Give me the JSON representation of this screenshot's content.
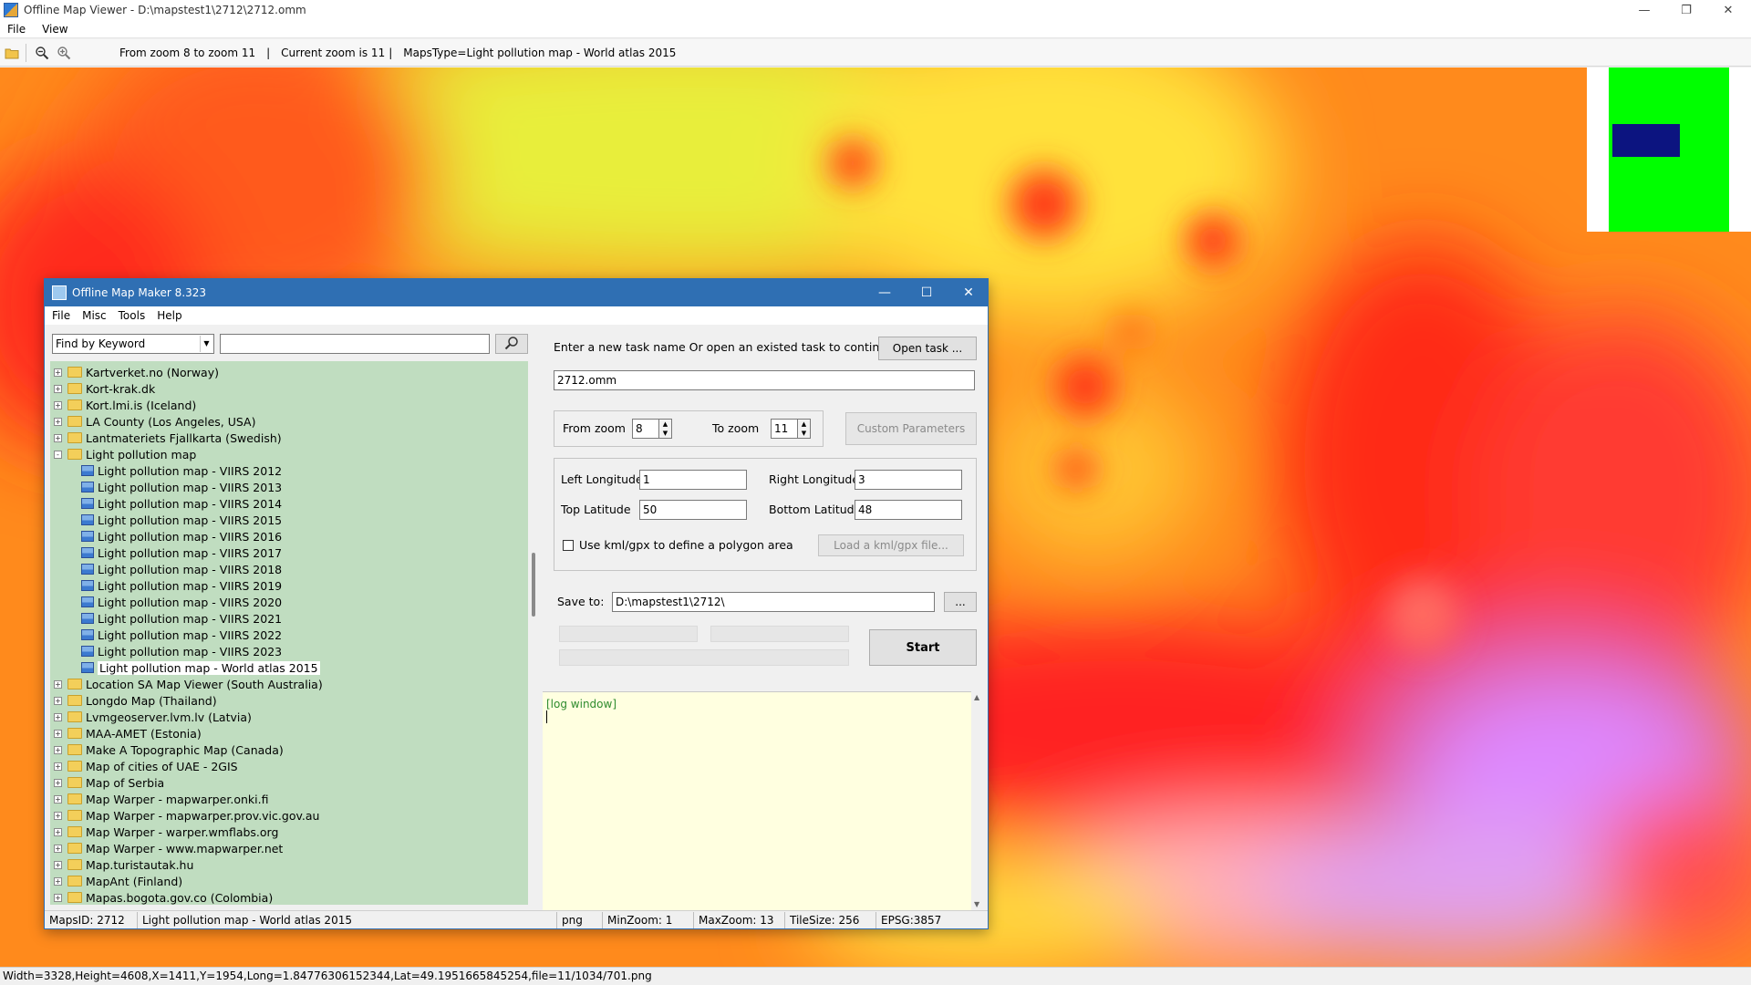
{
  "app": {
    "title": "Offline Map Viewer - D:\\mapstest1\\2712\\2712.omm",
    "menu": [
      "File",
      "View"
    ],
    "toolbar": {
      "zoom_range_text": "From zoom 8 to zoom 11",
      "current_zoom_text": "Current zoom is 11",
      "maps_type_text": "MapsType=Light pollution map - World atlas 2015",
      "separator": "|"
    },
    "status_text": "Width=3328,Height=4608,X=1411,Y=1954,Long=1.84776306152344,Lat=49.1951665845254,file=11/1034/701.png"
  },
  "dialog": {
    "title": "Offline Map Maker 8.323",
    "menu": [
      "File",
      "Misc",
      "Tools",
      "Help"
    ],
    "search": {
      "mode": "Find by Keyword",
      "query": ""
    },
    "tree": [
      {
        "label": "Kartverket.no (Norway)",
        "type": "folder",
        "level": 0,
        "expander": "+"
      },
      {
        "label": "Kort-krak.dk",
        "type": "folder",
        "level": 0,
        "expander": "+"
      },
      {
        "label": "Kort.lmi.is (Iceland)",
        "type": "folder",
        "level": 0,
        "expander": "+"
      },
      {
        "label": "LA County (Los Angeles, USA)",
        "type": "folder",
        "level": 0,
        "expander": "+"
      },
      {
        "label": "Lantmateriets Fjallkarta (Swedish)",
        "type": "folder",
        "level": 0,
        "expander": "+"
      },
      {
        "label": "Light pollution map",
        "type": "folder",
        "level": 0,
        "expander": "-"
      },
      {
        "label": "Light pollution map - VIIRS 2012",
        "type": "map",
        "level": 1
      },
      {
        "label": "Light pollution map - VIIRS 2013",
        "type": "map",
        "level": 1
      },
      {
        "label": "Light pollution map - VIIRS 2014",
        "type": "map",
        "level": 1
      },
      {
        "label": "Light pollution map - VIIRS 2015",
        "type": "map",
        "level": 1
      },
      {
        "label": "Light pollution map - VIIRS 2016",
        "type": "map",
        "level": 1
      },
      {
        "label": "Light pollution map - VIIRS 2017",
        "type": "map",
        "level": 1
      },
      {
        "label": "Light pollution map - VIIRS 2018",
        "type": "map",
        "level": 1
      },
      {
        "label": "Light pollution map - VIIRS 2019",
        "type": "map",
        "level": 1
      },
      {
        "label": "Light pollution map - VIIRS 2020",
        "type": "map",
        "level": 1
      },
      {
        "label": "Light pollution map - VIIRS 2021",
        "type": "map",
        "level": 1
      },
      {
        "label": "Light pollution map - VIIRS 2022",
        "type": "map",
        "level": 1
      },
      {
        "label": "Light pollution map - VIIRS 2023",
        "type": "map",
        "level": 1
      },
      {
        "label": "Light pollution map - World atlas 2015",
        "type": "map",
        "level": 1,
        "selected": true
      },
      {
        "label": "Location SA Map Viewer (South Australia)",
        "type": "folder",
        "level": 0,
        "expander": "+"
      },
      {
        "label": "Longdo Map (Thailand)",
        "type": "folder",
        "level": 0,
        "expander": "+"
      },
      {
        "label": "Lvmgeoserver.lvm.lv (Latvia)",
        "type": "folder",
        "level": 0,
        "expander": "+"
      },
      {
        "label": "MAA-AMET (Estonia)",
        "type": "folder",
        "level": 0,
        "expander": "+"
      },
      {
        "label": "Make A Topographic Map (Canada)",
        "type": "folder",
        "level": 0,
        "expander": "+"
      },
      {
        "label": "Map of cities of UAE - 2GIS",
        "type": "folder",
        "level": 0,
        "expander": "+"
      },
      {
        "label": "Map of Serbia",
        "type": "folder",
        "level": 0,
        "expander": "+"
      },
      {
        "label": "Map Warper - mapwarper.onki.fi",
        "type": "folder",
        "level": 0,
        "expander": "+"
      },
      {
        "label": "Map Warper - mapwarper.prov.vic.gov.au",
        "type": "folder",
        "level": 0,
        "expander": "+"
      },
      {
        "label": "Map Warper - warper.wmflabs.org",
        "type": "folder",
        "level": 0,
        "expander": "+"
      },
      {
        "label": "Map Warper - www.mapwarper.net",
        "type": "folder",
        "level": 0,
        "expander": "+"
      },
      {
        "label": "Map.turistautak.hu",
        "type": "folder",
        "level": 0,
        "expander": "+"
      },
      {
        "label": "MapAnt (Finland)",
        "type": "folder",
        "level": 0,
        "expander": "+"
      },
      {
        "label": "Mapas.bogota.gov.co (Colombia)",
        "type": "folder",
        "level": 0,
        "expander": "+"
      }
    ],
    "task": {
      "prompt": "Enter a new task name Or open an existed task to continue:",
      "open_button": "Open task ...",
      "task_name": "2712.omm"
    },
    "zoom": {
      "from_label": "From zoom",
      "from_value": "8",
      "to_label": "To zoom",
      "to_value": "11",
      "custom_button": "Custom Parameters"
    },
    "bounds": {
      "left_label": "Left Longitude",
      "left_value": "1",
      "right_label": "Right Longitude",
      "right_value": "3",
      "top_label": "Top Latitude",
      "top_value": "50",
      "bottom_label": "Bottom Latitude",
      "bottom_value": "48",
      "kml_checkbox_label": "Use kml/gpx to define a polygon area",
      "kml_checked": false,
      "kml_button": "Load a kml/gpx file..."
    },
    "save": {
      "label": "Save to:",
      "path": "D:\\mapstest1\\2712\\",
      "browse_button": "...",
      "start_button": "Start"
    },
    "log": {
      "text": "[log window]"
    },
    "status": {
      "maps_id": "MapsID: 2712",
      "map_name": "Light pollution map - World atlas 2015",
      "format": "png",
      "min_zoom": "MinZoom: 1",
      "max_zoom": "MaxZoom: 13",
      "tile_size": "TileSize: 256",
      "epsg": "EPSG:3857"
    }
  },
  "colors": {
    "map_low": "#ffff33",
    "map_mid": "#ff8a1c",
    "map_high": "#ff1a1a",
    "map_peak": "#dd88ff",
    "tree_bg": "#c0ddc0",
    "dialog_titlebar": "#2f6fb3",
    "log_bg": "#ffffe0",
    "minimap_area": "#00ff00",
    "minimap_viewport": "#0c1480"
  }
}
